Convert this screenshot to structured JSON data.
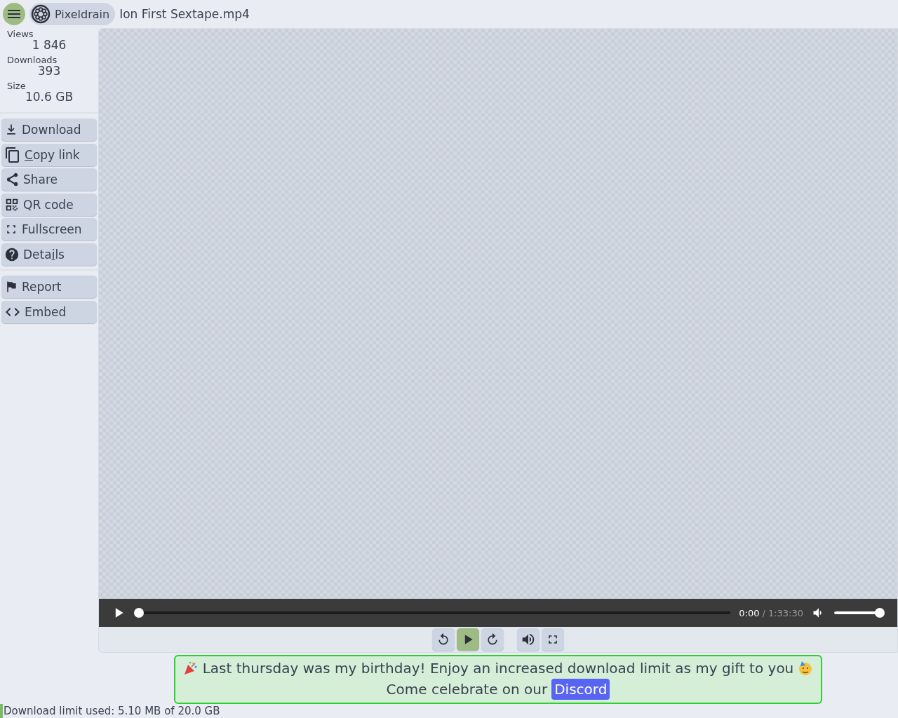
{
  "header": {
    "brand": "Pixeldrain",
    "file_name": "Ion First Sextape.mp4"
  },
  "stats": [
    {
      "label": "Views",
      "value": "1 846"
    },
    {
      "label": "Downloads",
      "value": "393"
    },
    {
      "label": "Size",
      "value": "10.6 GB"
    }
  ],
  "actions": [
    {
      "kind": "download",
      "before": "Download"
    },
    {
      "kind": "copy",
      "key": "C",
      "after": "opy link"
    },
    {
      "kind": "share",
      "before": "Share"
    },
    {
      "kind": "qr",
      "before": "QR code"
    },
    {
      "kind": "fullscreen",
      "before": "Fullscreen"
    },
    {
      "kind": "details",
      "before": "Deta",
      "key": "i",
      "after": "ls"
    }
  ],
  "secondary_actions": [
    {
      "kind": "report",
      "before": "Report"
    },
    {
      "kind": "embed",
      "before": "Embed"
    }
  ],
  "player": {
    "playing": false,
    "progress": {
      "level": 0
    },
    "current_time": "0:00",
    "separator": "/",
    "duration": "1:33:30",
    "volume": {
      "level": 1
    }
  },
  "controls": [
    {
      "kind": "rewind",
      "selected": false
    },
    {
      "kind": "play",
      "selected": true
    },
    {
      "kind": "forward",
      "selected": false
    },
    {
      "kind": "volume",
      "selected": false
    },
    {
      "kind": "fullscreen",
      "selected": false
    }
  ],
  "banner": {
    "message": "Last thursday was my birthday! Enjoy an increased download limit as my gift to you",
    "invite": "Come celebrate on our",
    "link": "Discord"
  },
  "footer": {
    "limit_text": "Download limit used: 5.10 MB of 20.0 GB",
    "limit": {
      "level": 0.000255
    }
  }
}
